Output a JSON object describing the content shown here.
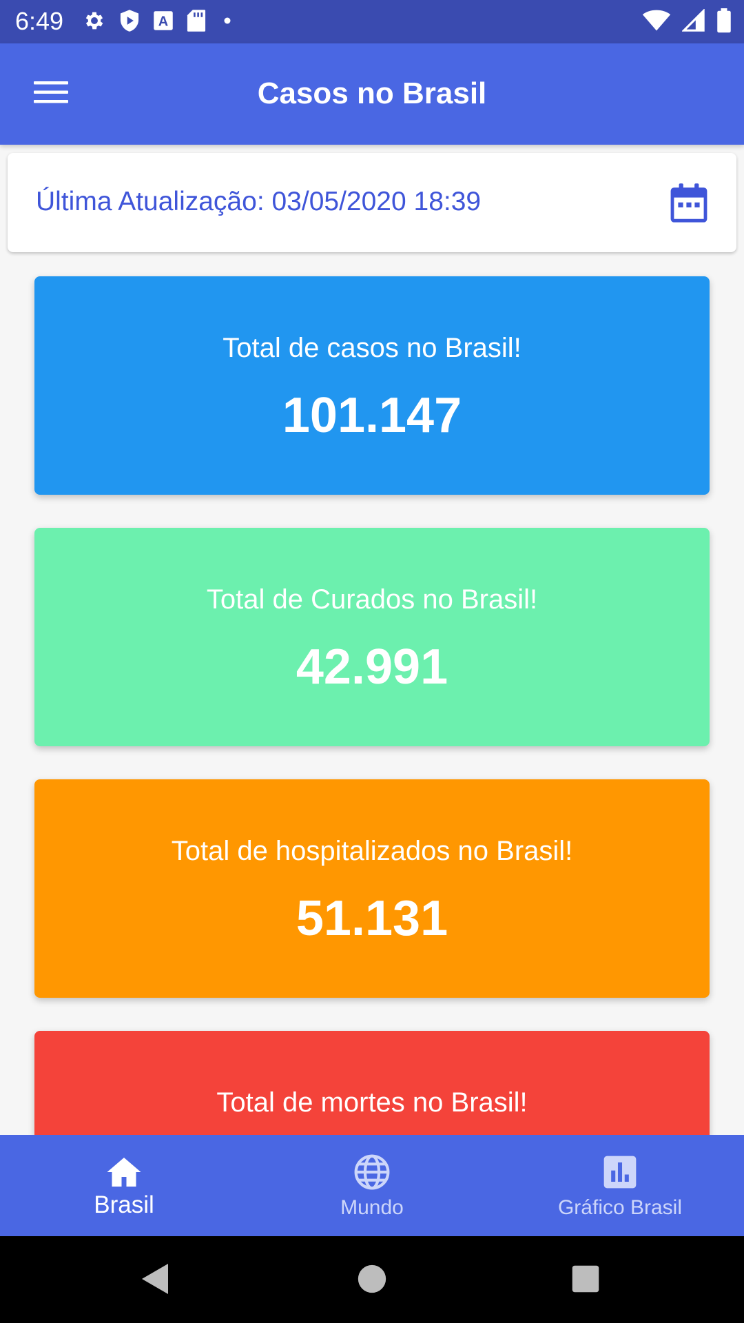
{
  "status_bar": {
    "time": "6:49",
    "icons_left": [
      "gear-icon",
      "shield-play-icon",
      "text-a-icon",
      "sd-card-icon",
      "dot-icon"
    ],
    "icons_right": [
      "wifi-icon",
      "signal-icon",
      "battery-icon"
    ],
    "background": "#3a4bb0"
  },
  "app_bar": {
    "title": "Casos no Brasil",
    "background": "#4a67e3",
    "menu_icon": "menu-icon"
  },
  "update": {
    "text": "Última Atualização: 03/05/2020 18:39",
    "text_color": "#3f55d9",
    "icon": "calendar-icon"
  },
  "cards": [
    {
      "label": "Total de casos no Brasil!",
      "value": "101.147",
      "color": "#2196f0"
    },
    {
      "label": "Total de Curados no Brasil!",
      "value": "42.991",
      "color": "#6cf0ae"
    },
    {
      "label": "Total de hospitalizados no Brasil!",
      "value": "51.131",
      "color": "#ff9701"
    },
    {
      "label": "Total de mortes no Brasil!",
      "value": "",
      "color": "#f4433a"
    }
  ],
  "bottom_nav": {
    "items": [
      {
        "label": "Brasil",
        "icon": "home-icon",
        "active": true
      },
      {
        "label": "Mundo",
        "icon": "globe-icon",
        "active": false
      },
      {
        "label": "Gráfico Brasil",
        "icon": "bar-chart-icon",
        "active": false
      }
    ]
  },
  "system_nav": {
    "buttons": [
      "back-icon",
      "home-circle-icon",
      "recents-icon"
    ]
  }
}
